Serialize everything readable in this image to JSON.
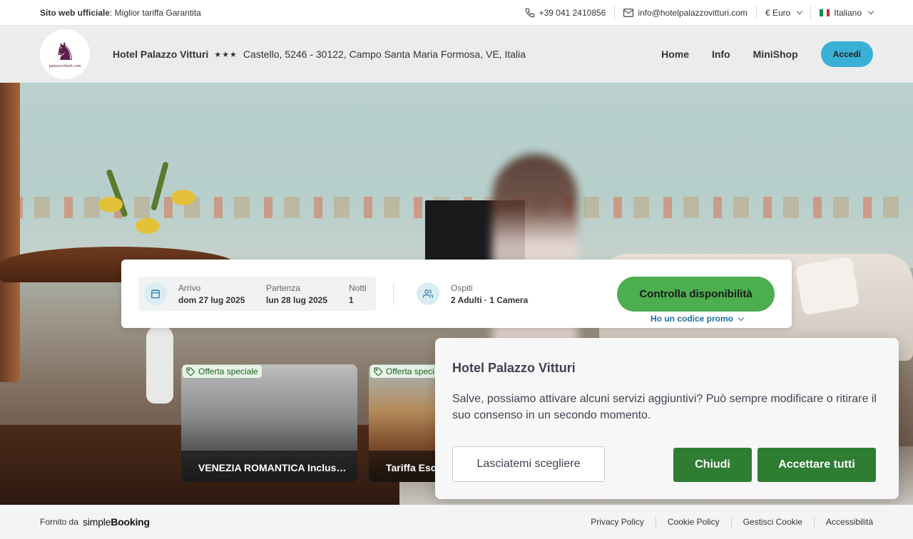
{
  "topbar": {
    "official_bold": "Sito web ufficiale",
    "official_rest": ": Miglior tariffa Garantita",
    "phone": "+39 041 2410856",
    "email": "info@hotelpalazzovitturi.com",
    "currency": "€ Euro",
    "language": "Italiano"
  },
  "header": {
    "logo_url_text": "palazzovitturi.com",
    "hotel_name": "Hotel Palazzo Vitturi",
    "stars": "★★★",
    "address": "Castello, 5246 - 30122, Campo Santa Maria Formosa, VE, Italia",
    "nav": [
      "Home",
      "Info",
      "MiniShop"
    ],
    "login": "Accedi"
  },
  "booking": {
    "arrival_label": "Arrivo",
    "arrival_value": "dom 27 lug 2025",
    "departure_label": "Partenza",
    "departure_value": "lun 28 lug 2025",
    "nights_label": "Notti",
    "nights_value": "1",
    "guests_label": "Ospiti",
    "guests_value": "2 Adulti · 1 Camera",
    "cta": "Controlla disponibilità",
    "promo": "Ho un codice promo"
  },
  "offers": [
    {
      "tag": "Offerta speciale",
      "title": "VENEZIA ROMANTICA Inclus…"
    },
    {
      "tag": "Offerta speci",
      "title": "Tariffa Esc"
    }
  ],
  "cookie": {
    "title": "Hotel Palazzo Vitturi",
    "text": "Salve, possiamo attivare alcuni servizi aggiuntivi? Può sempre modificare o ritirare il suo consenso in un secondo momento.",
    "choose": "Lasciatemi scegliere",
    "close": "Chiudi",
    "accept": "Accettare tutti"
  },
  "footer": {
    "powered_by": "Fornito da",
    "brand_light": "simple",
    "brand_bold": "Booking",
    "links": [
      "Privacy Policy",
      "Cookie Policy",
      "Gestisci Cookie",
      "Accessibilità"
    ]
  },
  "colors": {
    "cta_green": "#4cae4f",
    "cookie_green": "#2e7d32",
    "login_blue": "#3ab0d6",
    "promo_blue": "#1e6fa3"
  }
}
